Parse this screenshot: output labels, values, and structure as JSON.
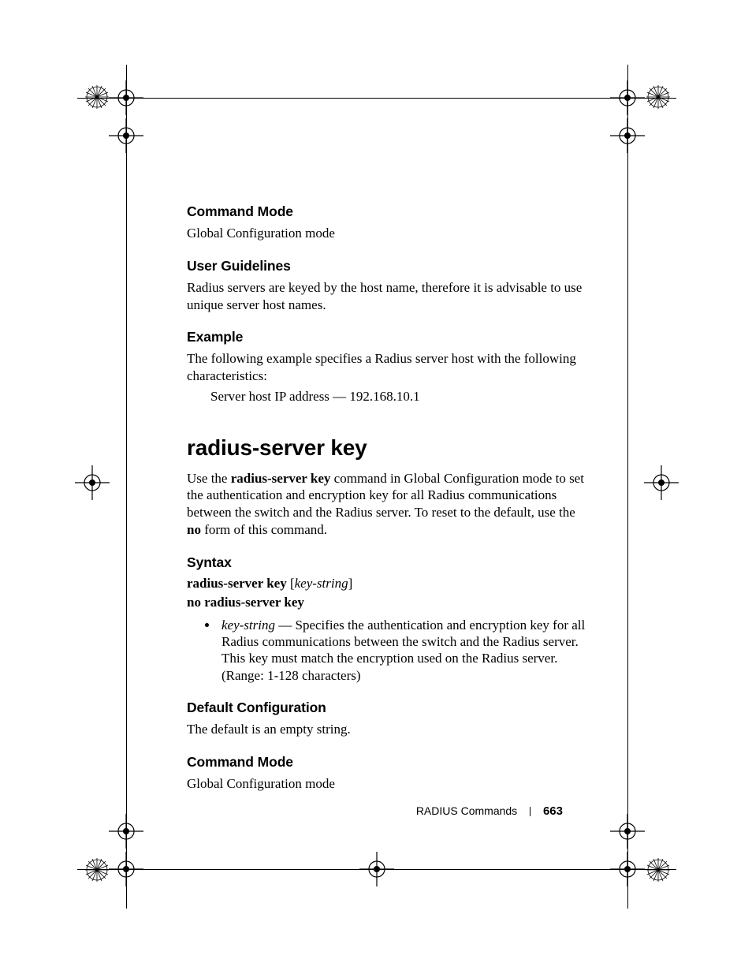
{
  "sections": {
    "cmdmode1": {
      "heading": "Command Mode",
      "text": "Global Configuration mode"
    },
    "guidelines": {
      "heading": "User Guidelines",
      "text": "Radius servers are keyed by the host name, therefore it is advisable to use unique server host names."
    },
    "example": {
      "heading": "Example",
      "text": "The following example specifies a Radius server host with the following characteristics:",
      "line1": "Server host IP address — 192.168.10.1"
    },
    "title": "radius-server key",
    "intro": {
      "pre": "Use the ",
      "cmd": "radius-server key",
      "mid": " command in Global Configuration mode to set the authentication and encryption key for all Radius communications between the switch and the Radius server. To reset to the default, use the ",
      "no": "no",
      "post": " form of this command."
    },
    "syntax": {
      "heading": "Syntax",
      "line1_cmd": "radius-server key",
      "line1_open": " [",
      "line1_arg": "key-string",
      "line1_close": "]",
      "line2": "no radius-server key",
      "bullet_arg": "key-string",
      "bullet_text": " — Specifies the authentication and encryption key for all Radius communications between the switch and the Radius server. This key must match the encryption used on the Radius server. (Range: 1-128 characters)"
    },
    "defcfg": {
      "heading": "Default Configuration",
      "text": "The default is an empty string."
    },
    "cmdmode2": {
      "heading": "Command Mode",
      "text": "Global Configuration mode"
    }
  },
  "footer": {
    "chapter": "RADIUS Commands",
    "page": "663"
  }
}
